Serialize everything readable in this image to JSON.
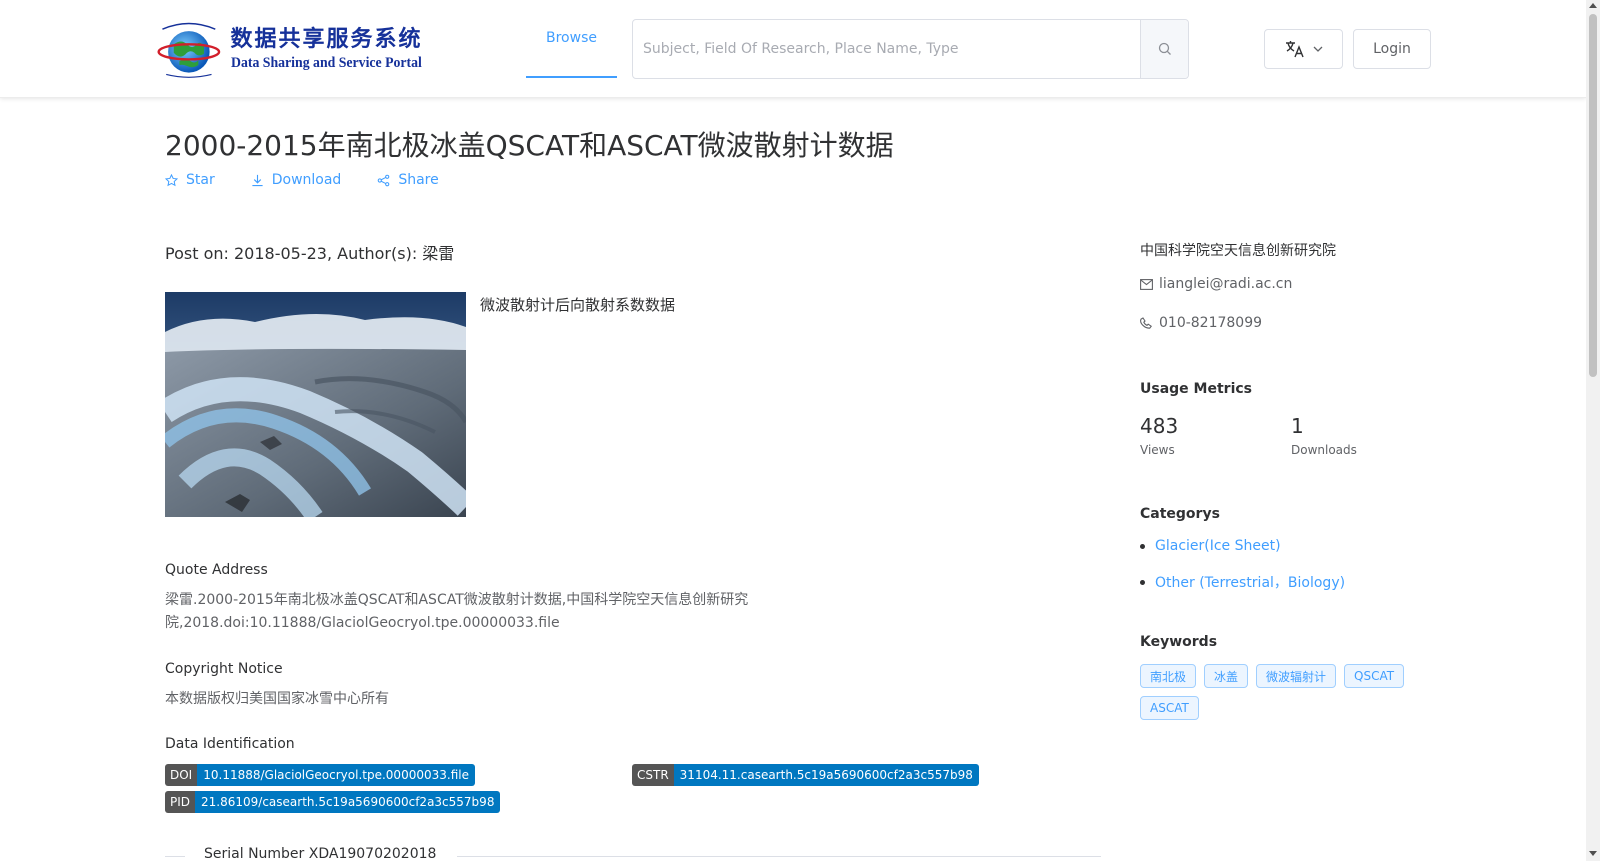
{
  "header": {
    "logo_cn": "数据共享服务系统",
    "logo_en": "Data Sharing and Service Portal",
    "nav_browse": "Browse",
    "search_placeholder": "Subject, Field Of Research, Place Name, Type",
    "login": "Login"
  },
  "dataset": {
    "title": "2000-2015年南北极冰盖QSCAT和ASCAT微波散射计数据",
    "actions": {
      "star": "Star",
      "download": "Download",
      "share": "Share"
    },
    "post_line": "Post on: 2018-05-23, Author(s): 梁雷",
    "abstract": "微波散射计后向散射系数数据",
    "quote_title": "Quote Address",
    "quote_text": "梁雷.2000-2015年南北极冰盖QSCAT和ASCAT微波散射计数据,中国科学院空天信息创新研究院,2018.doi:10.11888/GlaciolGeocryol.tpe.00000033.file",
    "copyright_title": "Copyright Notice",
    "copyright_text": "本数据版权归美国国家冰雪中心所有",
    "ident_title": "Data Identification",
    "doi_k": "DOI",
    "doi_v": "10.11888/GlaciolGeocryol.tpe.00000033.file",
    "cstr_k": "CSTR",
    "cstr_v": "31104.11.casearth.5c19a5690600cf2a3c557b98",
    "pid_k": "PID",
    "pid_v": "21.86109/casearth.5c19a5690600cf2a3c557b98",
    "serial": "Serial Number XDA19070202018"
  },
  "sidebar": {
    "org": "中国科学院空天信息创新研究院",
    "email": "lianglei@radi.ac.cn",
    "phone": "010-82178099",
    "metrics_title": "Usage Metrics",
    "views_num": "483",
    "views_label": "Views",
    "downloads_num": "1",
    "downloads_label": "Downloads",
    "categories_title": "Categorys",
    "categories": [
      "Glacier(Ice Sheet)",
      "Other (Terrestrial，Biology)"
    ],
    "keywords_title": "Keywords",
    "keywords": [
      "南北极",
      "冰盖",
      "微波辐射计",
      "QSCAT",
      "ASCAT"
    ]
  },
  "colors": {
    "accent": "#409eff",
    "brand": "#16319a",
    "badge_value": "#0077c0"
  }
}
